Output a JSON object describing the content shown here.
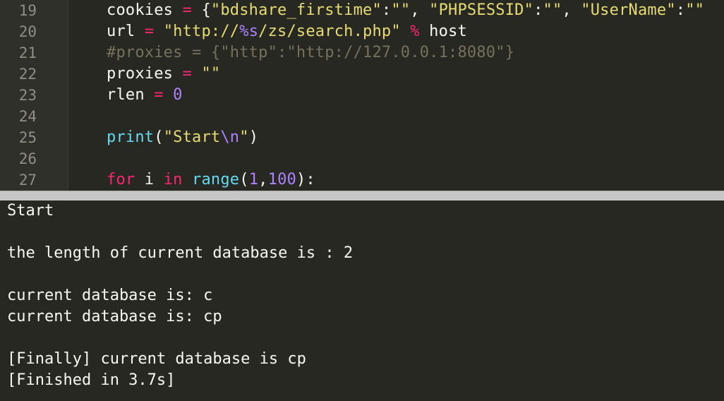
{
  "editor": {
    "lines": [
      {
        "num": "19",
        "parts": [
          [
            "plain",
            "cookies "
          ],
          [
            "op",
            "="
          ],
          [
            "plain",
            " {"
          ],
          [
            "str",
            "\"bdshare_firstime\""
          ],
          [
            "plain",
            ":"
          ],
          [
            "str",
            "\"\""
          ],
          [
            "plain",
            ", "
          ],
          [
            "str",
            "\"PHPSESSID\""
          ],
          [
            "plain",
            ":"
          ],
          [
            "str",
            "\"\""
          ],
          [
            "plain",
            ", "
          ],
          [
            "str",
            "\"UserName\""
          ],
          [
            "plain",
            ":"
          ],
          [
            "str",
            "\"\""
          ]
        ]
      },
      {
        "num": "20",
        "parts": [
          [
            "plain",
            "url "
          ],
          [
            "op",
            "="
          ],
          [
            "plain",
            " "
          ],
          [
            "str",
            "\"http://"
          ],
          [
            "num",
            "%s"
          ],
          [
            "str",
            "/zs/search.php\""
          ],
          [
            "plain",
            " "
          ],
          [
            "op",
            "%"
          ],
          [
            "plain",
            " host"
          ]
        ]
      },
      {
        "num": "21",
        "parts": [
          [
            "cmt",
            "#proxies = {\"http\":\"http://127.0.0.1:8080\"}"
          ]
        ]
      },
      {
        "num": "22",
        "parts": [
          [
            "plain",
            "proxies "
          ],
          [
            "op",
            "="
          ],
          [
            "plain",
            " "
          ],
          [
            "str",
            "\"\""
          ]
        ]
      },
      {
        "num": "23",
        "parts": [
          [
            "plain",
            "rlen "
          ],
          [
            "op",
            "="
          ],
          [
            "plain",
            " "
          ],
          [
            "num",
            "0"
          ]
        ]
      },
      {
        "num": "24",
        "parts": []
      },
      {
        "num": "25",
        "parts": [
          [
            "fn",
            "print"
          ],
          [
            "plain",
            "("
          ],
          [
            "str",
            "\"Start"
          ],
          [
            "num",
            "\\n"
          ],
          [
            "str",
            "\""
          ],
          [
            "plain",
            ")"
          ]
        ]
      },
      {
        "num": "26",
        "parts": []
      },
      {
        "num": "27",
        "parts": [
          [
            "kw",
            "for"
          ],
          [
            "plain",
            " i "
          ],
          [
            "kw",
            "in"
          ],
          [
            "plain",
            " "
          ],
          [
            "fn",
            "range"
          ],
          [
            "plain",
            "("
          ],
          [
            "num",
            "1"
          ],
          [
            "plain",
            ","
          ],
          [
            "num",
            "100"
          ],
          [
            "plain",
            "):"
          ]
        ]
      }
    ]
  },
  "console": {
    "lines": [
      "Start",
      "",
      "the length of current database is : 2",
      "",
      "current database is: c",
      "current database is: cp",
      "",
      "[Finally] current database is cp",
      "[Finished in 3.7s]"
    ]
  },
  "colors": {
    "background": "#272822",
    "string": "#e6db74",
    "operator": "#f92672",
    "number": "#ae81ff",
    "function": "#66d9ef",
    "comment": "#75715e",
    "splitter": "#c7c7c7"
  }
}
